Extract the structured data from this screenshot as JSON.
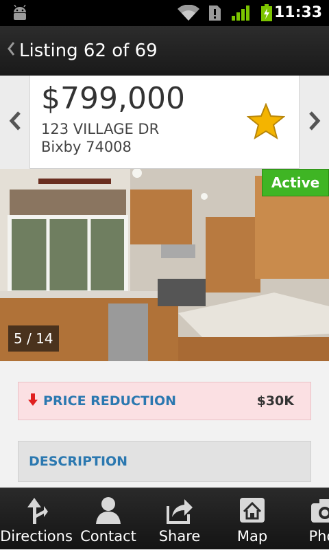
{
  "status_bar": {
    "time": "11:33",
    "icons": [
      "android-icon",
      "wifi-icon",
      "sim-alert-icon",
      "signal-icon",
      "battery-charging-icon"
    ]
  },
  "title_bar": {
    "back_icon": "chevron-left-icon",
    "title": "Listing 62 of 69"
  },
  "listing": {
    "price": "$799,000",
    "address_line1": "123 VILLAGE DR",
    "address_line2": "Bixby 74008",
    "favorite_icon": "star-icon",
    "star_color": "#f4b400"
  },
  "photo": {
    "status_badge": "Active",
    "status_color": "#3fb524",
    "counter": "5 / 14"
  },
  "sections": {
    "price_reduction_label": "PRICE REDUCTION",
    "price_reduction_amount": "$30K",
    "description_label": "DESCRIPTION"
  },
  "bottom_tabs": [
    {
      "label": "Directions",
      "icon": "directions-icon"
    },
    {
      "label": "Contact",
      "icon": "contact-icon"
    },
    {
      "label": "Share",
      "icon": "share-icon"
    },
    {
      "label": "Map",
      "icon": "map-icon"
    },
    {
      "label": "Phot",
      "icon": "camera-icon"
    }
  ],
  "colors": {
    "link_blue": "#2b78b0",
    "reduction_bg": "#fbe0e3",
    "reduction_arrow": "#e02020"
  }
}
